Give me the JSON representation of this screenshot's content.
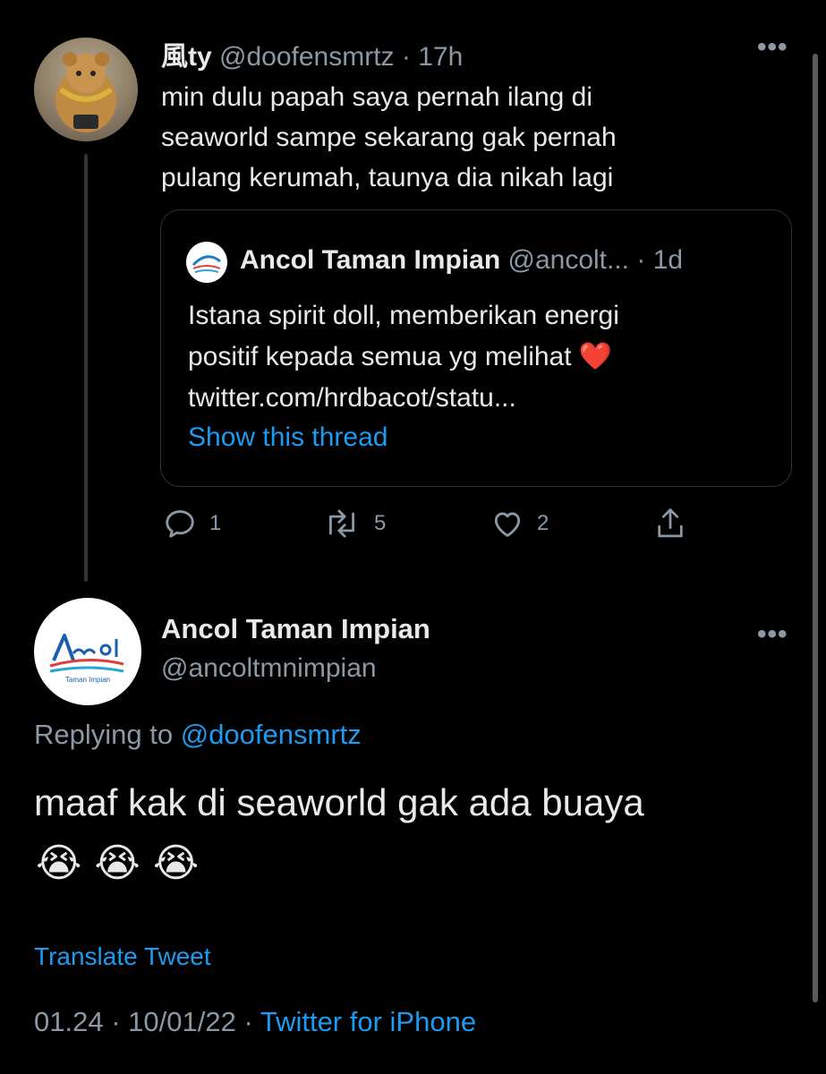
{
  "parent_tweet": {
    "display_name": "風ty",
    "handle": "@doofensmrtz",
    "separator": "·",
    "time": "17h",
    "more": "•••",
    "text_lines": [
      "min dulu papah saya pernah ilang di",
      "seaworld sampe sekarang gak pernah",
      "pulang kerumah, taunya dia nikah lagi"
    ],
    "quote": {
      "display_name": "Ancol Taman Impian",
      "handle": "@ancolt...",
      "separator": "·",
      "time": "1d",
      "text_lines": [
        "Istana spirit doll, memberikan energi",
        "positif kepada semua yg melihat",
        "twitter.com/hrdbacot/statu..."
      ],
      "heart_emoji": "❤️",
      "show_thread": "Show this thread"
    },
    "actions": {
      "reply_count": "1",
      "retweet_count": "5",
      "like_count": "2"
    },
    "icons": [
      "reply-icon",
      "retweet-icon",
      "like-icon",
      "share-icon"
    ]
  },
  "main_tweet": {
    "display_name": "Ancol Taman Impian",
    "handle": "@ancoltmnimpian",
    "more": "•••",
    "replying_label": "Replying to",
    "replying_handle": "@doofensmrtz",
    "text": "maaf kak di seaworld gak ada buaya",
    "emojis": [
      "😭",
      "😭",
      "😭"
    ],
    "translate": "Translate Tweet",
    "time": "01.24",
    "separator1": "·",
    "date": "10/01/22",
    "separator2": "·",
    "source": "Twitter for iPhone"
  },
  "colors": {
    "background": "#000000",
    "text": "#e7e9ea",
    "muted": "#8b98a5",
    "link": "#1d9bf0",
    "border": "#2f3336"
  }
}
